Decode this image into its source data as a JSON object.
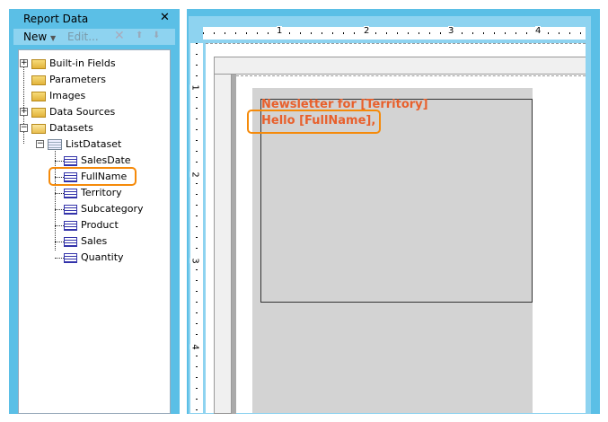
{
  "panel": {
    "title": "Report Data",
    "close_icon": "close-icon",
    "toolbar": {
      "new_label": "New",
      "edit_label": "Edit..."
    }
  },
  "tree": {
    "root": [
      {
        "label": "Built-in Fields"
      },
      {
        "label": "Parameters"
      },
      {
        "label": "Images"
      },
      {
        "label": "Data Sources"
      },
      {
        "label": "Datasets"
      }
    ],
    "dataset": {
      "label": "ListDataset",
      "fields": [
        "SalesDate",
        "FullName",
        "Territory",
        "Subcategory",
        "Product",
        "Sales",
        "Quantity"
      ]
    },
    "highlighted_field": "FullName"
  },
  "ruler": {
    "h": [
      "1",
      "2",
      "3",
      "4"
    ],
    "v": [
      "1",
      "2",
      "3",
      "4"
    ]
  },
  "report": {
    "line1": "Newsletter for [Territory]",
    "line2": "Hello [FullName],"
  },
  "colors": {
    "panel": "#5bbfe6",
    "accent": "#8ed3f0",
    "highlight": "#f58a0a",
    "expression": "#e8602c"
  }
}
